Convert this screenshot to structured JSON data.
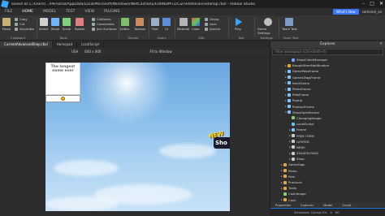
{
  "titlebar": {
    "title": "Saved as C:/Users/.../Personal/AppData/Local/Microsoft/Windows/INetCache/IE/EURNDMTZ/CurrentAdvancedShop.rbxl - Roblox Studio"
  },
  "ribbon_tabs": [
    "FILE",
    "HOME",
    "MODEL",
    "TEST",
    "VIEW",
    "PLUGINS"
  ],
  "account": {
    "whats_new": "What's New",
    "user": "cameron_xx"
  },
  "ribbon": {
    "clipboard": {
      "paste": "Paste",
      "copy": "Copy",
      "cut": "Cut",
      "duplicate": "Duplicate",
      "label": "Clipboard"
    },
    "tools": {
      "select": "Select",
      "move": "Move",
      "scale": "Scale",
      "rotate": "Rotate",
      "label": "Tools"
    },
    "collisions": {
      "collisions": "Collisions",
      "constraints": "Constraints",
      "join_surfaces": "Join Surfaces"
    },
    "terrain": {
      "editor": "Editor",
      "toolbox": "Toolbox",
      "label": "Terrain"
    },
    "insert": {
      "part": "Part",
      "ui": "UI",
      "label": "Insert"
    },
    "edit": {
      "material": "Material",
      "color": "Color",
      "group": "Group",
      "lock": "Lock",
      "anchor": "Anchor",
      "label": "Edit"
    },
    "test": {
      "play": "Play",
      "label": "Test"
    },
    "settings": {
      "game_settings": "Game Settings",
      "label": "Settings"
    },
    "team_test": {
      "team_test": "Team Test",
      "label": "Team Test"
    }
  },
  "doc_tabs": [
    "CurrentAdvancedShop.rbxl",
    "Homepad",
    "LocalScript"
  ],
  "viewport_toolbar": {
    "device": "USA",
    "resolution": "640 x 400",
    "fit": "Fit to Window"
  },
  "canvas": {
    "frame_text": "The longest name ever",
    "badge_text": "NEW",
    "shop_text": "Sho"
  },
  "explorer": {
    "title": "Explorer",
    "filter_placeholder": "Filter workspace (Ctrl+Shift+X)",
    "items": [
      {
        "label": "ShopClientManager",
        "icon": "script",
        "indent": 4,
        "arrow": ""
      },
      {
        "label": "BoughtItemNotification",
        "icon": "folder",
        "indent": 3,
        "arrow": "▸"
      },
      {
        "label": "GamePassFrame",
        "icon": "frame",
        "indent": 3,
        "arrow": "▸"
      },
      {
        "label": "GamesTagsFrame",
        "icon": "frame",
        "indent": 3,
        "arrow": "▸"
      },
      {
        "label": "ItemFrame",
        "icon": "frame",
        "indent": 3,
        "arrow": "▸"
      },
      {
        "label": "PerksFrame",
        "icon": "frame",
        "indent": 3,
        "arrow": "▸"
      },
      {
        "label": "PetsFrame",
        "icon": "frame",
        "indent": 3,
        "arrow": "▸"
      },
      {
        "label": "PopUp",
        "icon": "frame",
        "indent": 3,
        "arrow": "▸"
      },
      {
        "label": "ProductFrame",
        "icon": "frame",
        "indent": 3,
        "arrow": "▸"
      },
      {
        "label": "ShopOpenButton",
        "icon": "frame",
        "indent": 3,
        "arrow": "▾"
      },
      {
        "label": "ChangingImage",
        "icon": "img",
        "indent": 4,
        "arrow": ""
      },
      {
        "label": "LocalScript",
        "icon": "local",
        "indent": 4,
        "arrow": ""
      },
      {
        "label": "Frame",
        "icon": "frame",
        "indent": 4,
        "arrow": "▸"
      },
      {
        "label": "FREE ITEM!",
        "icon": "text",
        "indent": 4,
        "arrow": "▸"
      },
      {
        "label": "LIMITED",
        "icon": "text",
        "indent": 4,
        "arrow": "▸"
      },
      {
        "label": "NEW!",
        "icon": "text",
        "indent": 4,
        "arrow": "▸"
      },
      {
        "label": "SEASON PASS",
        "icon": "text",
        "indent": 4,
        "arrow": "▸"
      },
      {
        "label": "Shop",
        "icon": "text",
        "indent": 4,
        "arrow": "▸"
      },
      {
        "label": "GameTags",
        "icon": "folder",
        "indent": 2,
        "arrow": "▸"
      },
      {
        "label": "Perks",
        "icon": "folder",
        "indent": 2,
        "arrow": "▸"
      },
      {
        "label": "Pets",
        "icon": "folder",
        "indent": 2,
        "arrow": "▸"
      },
      {
        "label": "Products",
        "icon": "folder",
        "indent": 2,
        "arrow": "▸"
      },
      {
        "label": "Trails",
        "icon": "folder",
        "indent": 2,
        "arrow": "▸"
      },
      {
        "label": "CashImage",
        "icon": "img",
        "indent": 2,
        "arrow": ""
      },
      {
        "label": "Cash",
        "icon": "folder",
        "indent": 2,
        "arrow": "▸"
      },
      {
        "label": "StarterPack",
        "icon": "pack",
        "indent": 1,
        "arrow": "▸",
        "selected": true
      }
    ]
  },
  "explorer_bottom": [
    "Properties",
    "Explorer",
    "Model",
    "Script"
  ],
  "statusbar": {
    "text": "Schedules: 12ms/s 0%",
    "coords": "0",
    "fps": "60"
  }
}
